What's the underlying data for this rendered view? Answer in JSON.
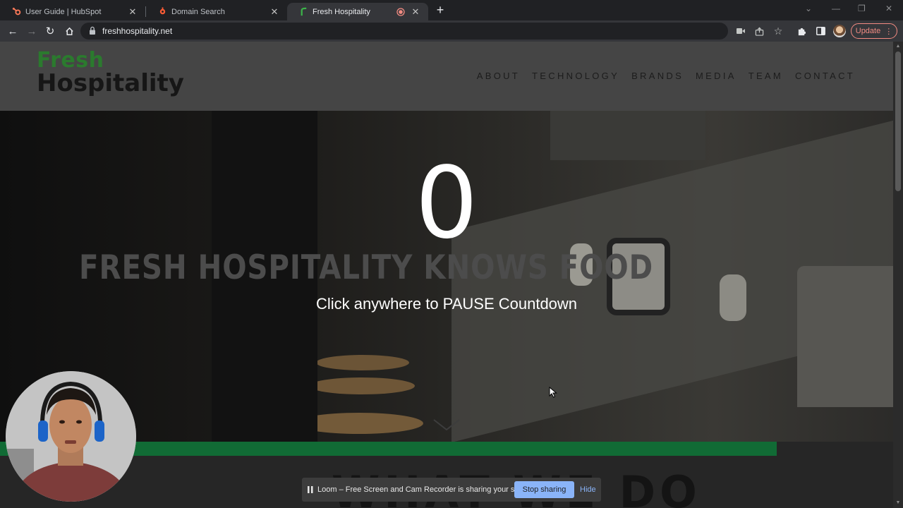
{
  "browser": {
    "tabs": [
      {
        "title": "User Guide | HubSpot",
        "icon": "hubspot-icon",
        "active": false
      },
      {
        "title": "Domain Search",
        "icon": "hubspot-sprocket-icon",
        "active": false
      },
      {
        "title": "Fresh Hospitality",
        "icon": "fresh-hospitality-icon",
        "active": true,
        "recording": true
      }
    ],
    "url": "freshhospitality.net",
    "update_label": "Update",
    "accent_color": "#f28b82"
  },
  "site": {
    "logo": {
      "line1": "Fresh",
      "line2": "Hospitality",
      "brand_color": "#2b7a2e"
    },
    "nav": [
      "ABOUT",
      "TECHNOLOGY",
      "BRANDS",
      "MEDIA",
      "TEAM",
      "CONTACT"
    ],
    "hero": {
      "countdown": "0",
      "title": "FRESH HOSPITALITY KNOWS FOOD",
      "caption": "Click anywhere to PAUSE Countdown"
    },
    "section_title": "WHAT WE DO",
    "green_bar_color": "#116b35"
  },
  "loom": {
    "message": "Loom – Free Screen and Cam Recorder is sharing your screen.",
    "stop_label": "Stop sharing",
    "hide_label": "Hide"
  }
}
